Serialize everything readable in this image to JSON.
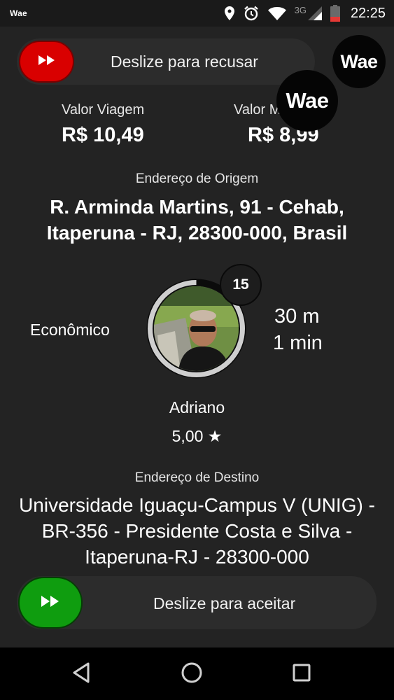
{
  "status_bar": {
    "app_logo": "Wae",
    "network_type": "3G",
    "time": "22:25"
  },
  "reject_slider": {
    "label": "Deslize para recusar",
    "color": "#d90000"
  },
  "accept_slider": {
    "label": "Deslize para aceitar",
    "color": "#0f9d0f"
  },
  "brand": {
    "logo_text": "Wae"
  },
  "fares": {
    "trip_value_label": "Valor Viagem",
    "trip_value": "R$ 10,49",
    "second_value_label": "Valor M",
    "second_value_label_suffix": "a",
    "second_value": "R$ 8,99"
  },
  "origin": {
    "label": "Endereço de Origem",
    "address": "R. Arminda Martins, 91 - Cehab, Itaperuna - RJ, 28300-000, Brasil"
  },
  "ride": {
    "category": "Econômico",
    "countdown": "15",
    "countdown_progress": 0.9,
    "distance": "30 m",
    "eta": "1 min"
  },
  "passenger": {
    "name": "Adriano",
    "rating": "5,00 ★"
  },
  "destination": {
    "label": "Endereço de Destino",
    "address": "Universidade Iguaçu-Campus V (UNIG) - BR-356 - Presidente Costa e Silva - Itaperuna-RJ - 28300-000"
  }
}
